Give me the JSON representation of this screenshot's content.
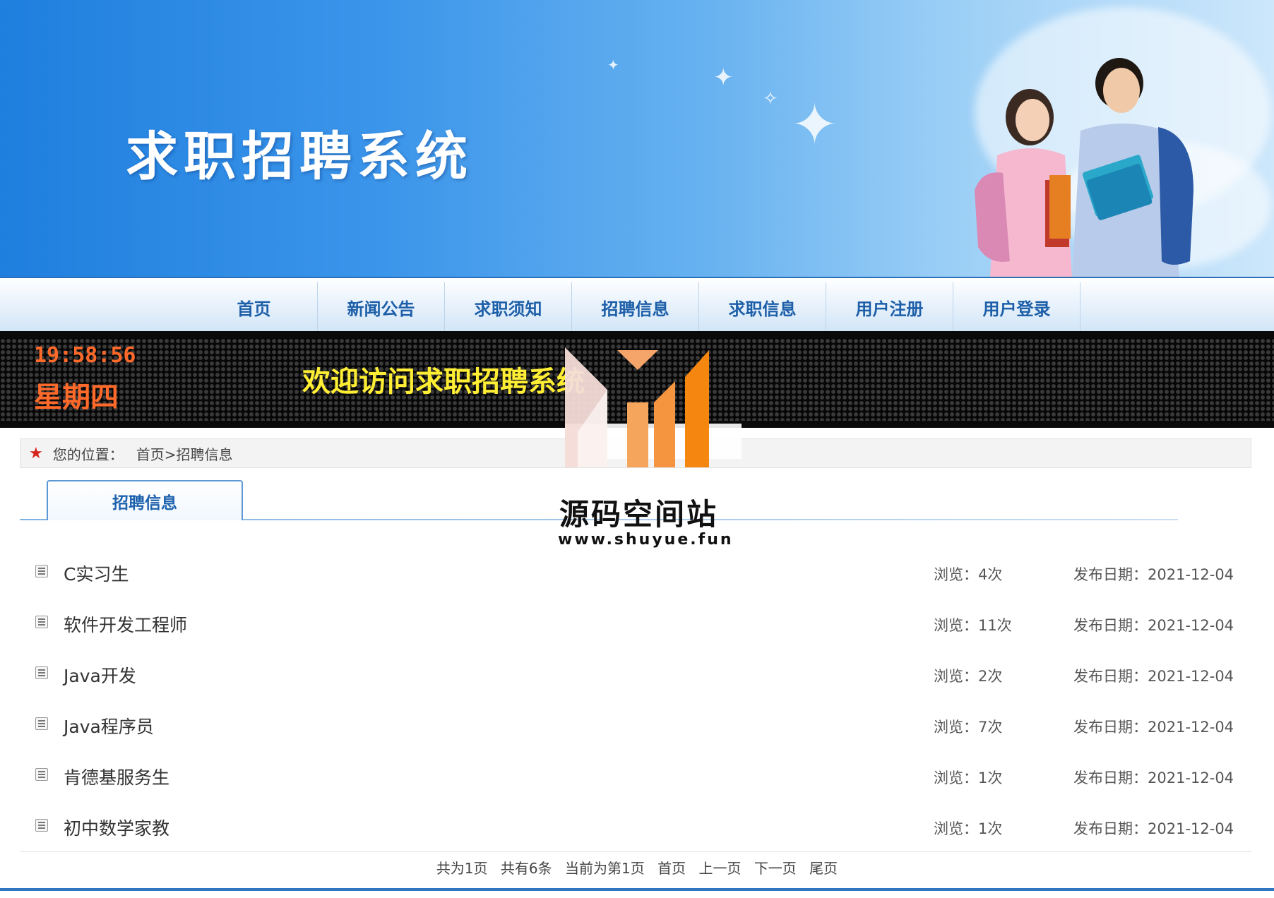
{
  "header": {
    "site_title": "求职招聘系统"
  },
  "nav": {
    "items": [
      {
        "label": "首页"
      },
      {
        "label": "新闻公告"
      },
      {
        "label": "求职须知"
      },
      {
        "label": "招聘信息"
      },
      {
        "label": "求职信息"
      },
      {
        "label": "用户注册"
      },
      {
        "label": "用户登录"
      }
    ]
  },
  "ticker": {
    "time": "19:58:56",
    "weekday": "星期四",
    "welcome": "欢迎访问求职招聘系统"
  },
  "breadcrumb": {
    "label": "您的位置：",
    "path": "首页>招聘信息"
  },
  "tab": {
    "label": "招聘信息"
  },
  "jobs": [
    {
      "title": "C实习生",
      "views": "浏览：4次",
      "date": "发布日期：2021-12-04"
    },
    {
      "title": "软件开发工程师",
      "views": "浏览：11次",
      "date": "发布日期：2021-12-04"
    },
    {
      "title": "Java开发",
      "views": "浏览：2次",
      "date": "发布日期：2021-12-04"
    },
    {
      "title": "Java程序员",
      "views": "浏览：7次",
      "date": "发布日期：2021-12-04"
    },
    {
      "title": "肯德基服务生",
      "views": "浏览：1次",
      "date": "发布日期：2021-12-04"
    },
    {
      "title": "初中数学家教",
      "views": "浏览：1次",
      "date": "发布日期：2021-12-04"
    }
  ],
  "pager": {
    "total_pages": "共为1页",
    "total_items": "共有6条",
    "current": "当前为第1页",
    "first": "首页",
    "prev": "上一页",
    "next": "下一页",
    "last": "尾页"
  },
  "watermark": {
    "title": "源码空间站",
    "url": "www.shuyue.fun"
  },
  "colors": {
    "nav_text": "#1d5fa8",
    "led_text_orange": "#ff6a2a",
    "led_text_yellow": "#ffee33",
    "star": "#d4241c",
    "footer_line": "#2f75c0"
  }
}
